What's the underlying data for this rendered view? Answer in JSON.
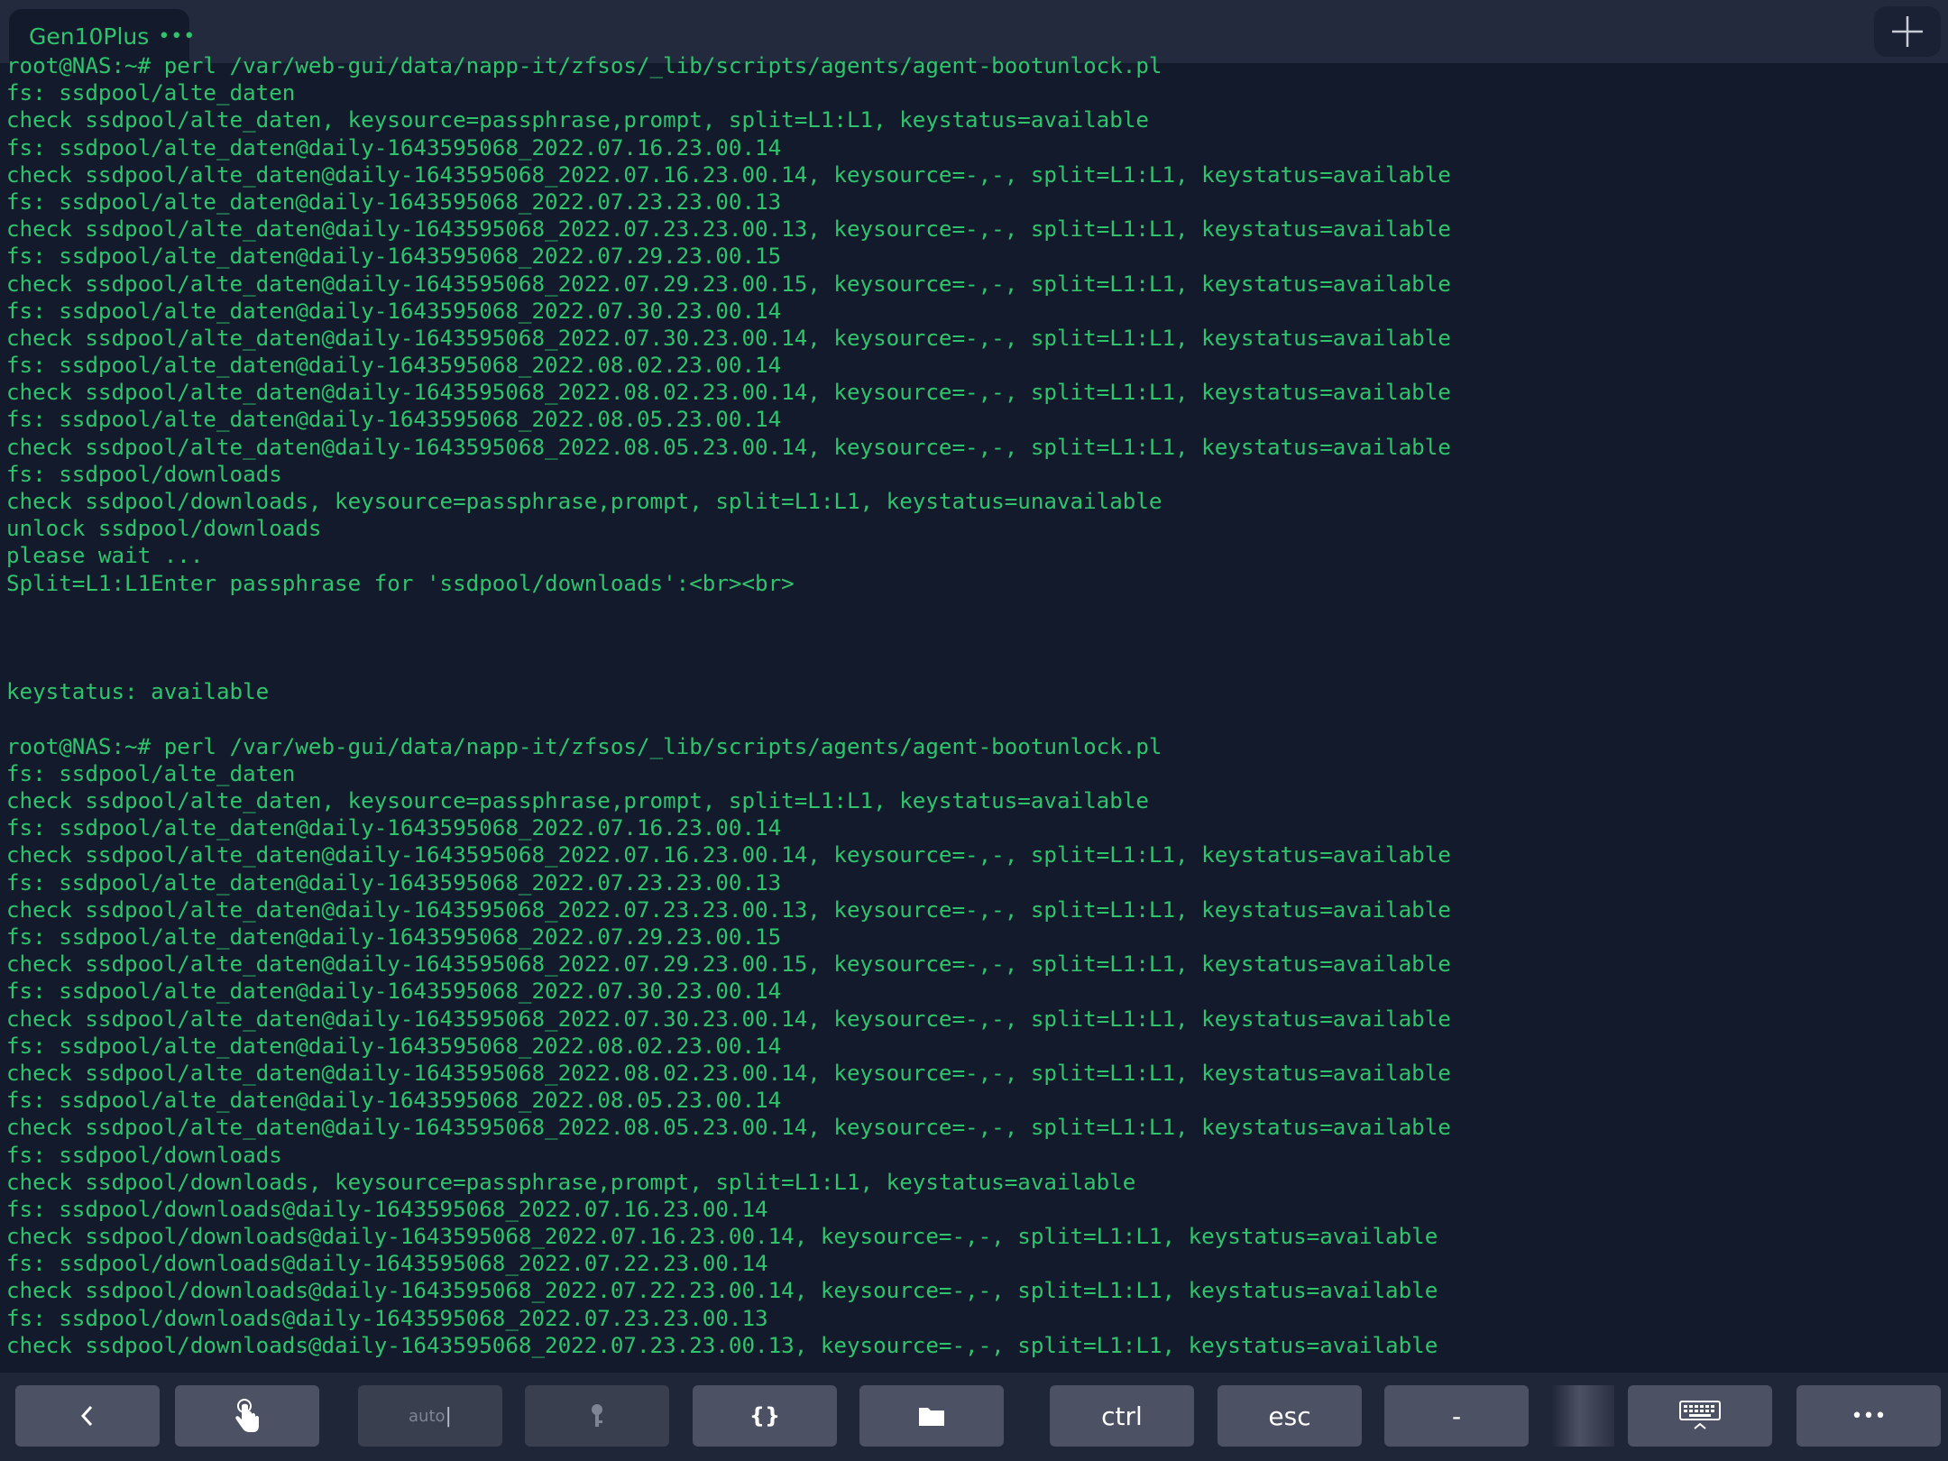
{
  "tab": {
    "title": "Gen10Plus",
    "menu": "•••"
  },
  "new_tab_icon": "plus-icon",
  "colors": {
    "terminal_bg": "#131a2c",
    "terminal_text": "#2fc46c",
    "toolbar_bg": "#1f2638",
    "key_bg": "#4c5163"
  },
  "terminal": {
    "lines": [
      "root@NAS:~# perl /var/web-gui/data/napp-it/zfsos/_lib/scripts/agents/agent-bootunlock.pl",
      "fs: ssdpool/alte_daten",
      "check ssdpool/alte_daten, keysource=passphrase,prompt, split=L1:L1, keystatus=available",
      "fs: ssdpool/alte_daten@daily-1643595068_2022.07.16.23.00.14",
      "check ssdpool/alte_daten@daily-1643595068_2022.07.16.23.00.14, keysource=-,-, split=L1:L1, keystatus=available",
      "fs: ssdpool/alte_daten@daily-1643595068_2022.07.23.23.00.13",
      "check ssdpool/alte_daten@daily-1643595068_2022.07.23.23.00.13, keysource=-,-, split=L1:L1, keystatus=available",
      "fs: ssdpool/alte_daten@daily-1643595068_2022.07.29.23.00.15",
      "check ssdpool/alte_daten@daily-1643595068_2022.07.29.23.00.15, keysource=-,-, split=L1:L1, keystatus=available",
      "fs: ssdpool/alte_daten@daily-1643595068_2022.07.30.23.00.14",
      "check ssdpool/alte_daten@daily-1643595068_2022.07.30.23.00.14, keysource=-,-, split=L1:L1, keystatus=available",
      "fs: ssdpool/alte_daten@daily-1643595068_2022.08.02.23.00.14",
      "check ssdpool/alte_daten@daily-1643595068_2022.08.02.23.00.14, keysource=-,-, split=L1:L1, keystatus=available",
      "fs: ssdpool/alte_daten@daily-1643595068_2022.08.05.23.00.14",
      "check ssdpool/alte_daten@daily-1643595068_2022.08.05.23.00.14, keysource=-,-, split=L1:L1, keystatus=available",
      "fs: ssdpool/downloads",
      "check ssdpool/downloads, keysource=passphrase,prompt, split=L1:L1, keystatus=unavailable",
      "unlock ssdpool/downloads",
      "please wait ...",
      "Split=L1:L1Enter passphrase for 'ssdpool/downloads':<br><br>",
      "",
      "",
      "",
      "keystatus: available",
      "",
      "root@NAS:~# perl /var/web-gui/data/napp-it/zfsos/_lib/scripts/agents/agent-bootunlock.pl",
      "fs: ssdpool/alte_daten",
      "check ssdpool/alte_daten, keysource=passphrase,prompt, split=L1:L1, keystatus=available",
      "fs: ssdpool/alte_daten@daily-1643595068_2022.07.16.23.00.14",
      "check ssdpool/alte_daten@daily-1643595068_2022.07.16.23.00.14, keysource=-,-, split=L1:L1, keystatus=available",
      "fs: ssdpool/alte_daten@daily-1643595068_2022.07.23.23.00.13",
      "check ssdpool/alte_daten@daily-1643595068_2022.07.23.23.00.13, keysource=-,-, split=L1:L1, keystatus=available",
      "fs: ssdpool/alte_daten@daily-1643595068_2022.07.29.23.00.15",
      "check ssdpool/alte_daten@daily-1643595068_2022.07.29.23.00.15, keysource=-,-, split=L1:L1, keystatus=available",
      "fs: ssdpool/alte_daten@daily-1643595068_2022.07.30.23.00.14",
      "check ssdpool/alte_daten@daily-1643595068_2022.07.30.23.00.14, keysource=-,-, split=L1:L1, keystatus=available",
      "fs: ssdpool/alte_daten@daily-1643595068_2022.08.02.23.00.14",
      "check ssdpool/alte_daten@daily-1643595068_2022.08.02.23.00.14, keysource=-,-, split=L1:L1, keystatus=available",
      "fs: ssdpool/alte_daten@daily-1643595068_2022.08.05.23.00.14",
      "check ssdpool/alte_daten@daily-1643595068_2022.08.05.23.00.14, keysource=-,-, split=L1:L1, keystatus=available",
      "fs: ssdpool/downloads",
      "check ssdpool/downloads, keysource=passphrase,prompt, split=L1:L1, keystatus=available",
      "fs: ssdpool/downloads@daily-1643595068_2022.07.16.23.00.14",
      "check ssdpool/downloads@daily-1643595068_2022.07.16.23.00.14, keysource=-,-, split=L1:L1, keystatus=available",
      "fs: ssdpool/downloads@daily-1643595068_2022.07.22.23.00.14",
      "check ssdpool/downloads@daily-1643595068_2022.07.22.23.00.14, keysource=-,-, split=L1:L1, keystatus=available",
      "fs: ssdpool/downloads@daily-1643595068_2022.07.23.23.00.13",
      "check ssdpool/downloads@daily-1643595068_2022.07.23.23.00.13, keysource=-,-, split=L1:L1, keystatus=available"
    ]
  },
  "toolbar": {
    "back_icon": "chevron-left-icon",
    "touch_icon": "hand-pointer-icon",
    "auto_label": "auto",
    "key_icon": "key-icon",
    "braces_label": "{}",
    "folder_icon": "folder-icon",
    "ctrl_label": "ctrl",
    "esc_label": "esc",
    "dash_label": "-",
    "keyboard_icon": "keyboard-hide-icon",
    "more_label": "•••"
  }
}
